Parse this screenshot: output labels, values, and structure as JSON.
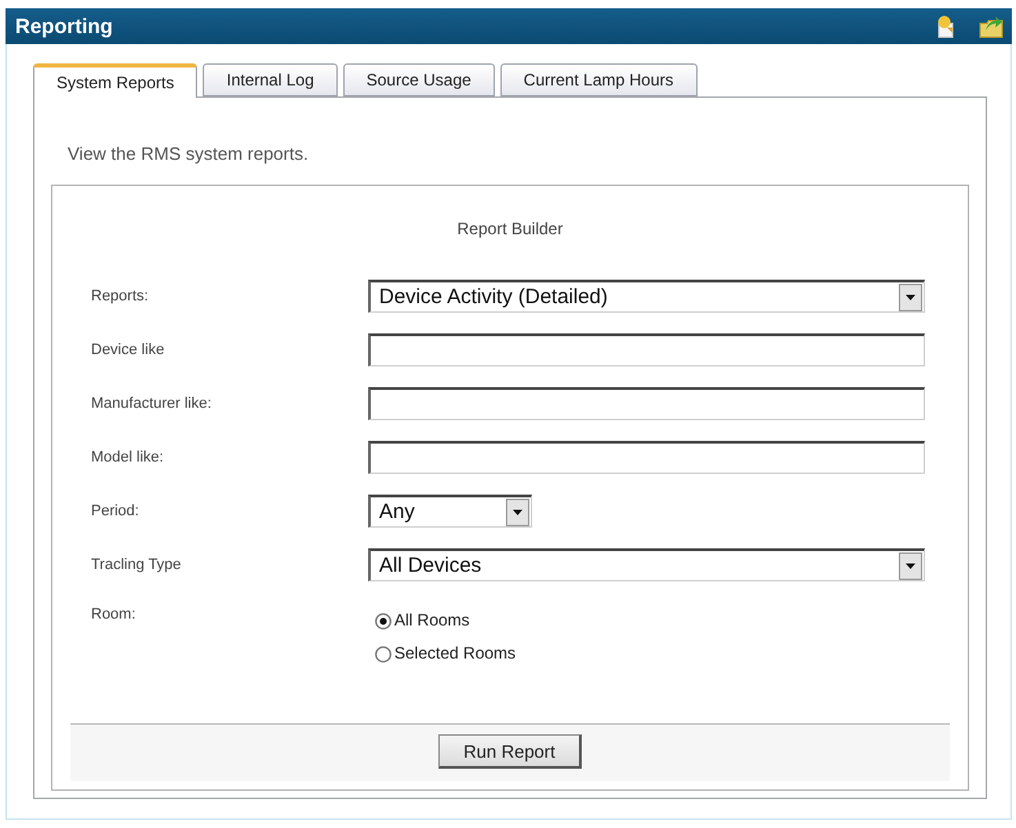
{
  "window": {
    "title": "Reporting"
  },
  "tabs": [
    {
      "label": "System Reports",
      "selected": true
    },
    {
      "label": "Internal Log",
      "selected": false
    },
    {
      "label": "Source Usage",
      "selected": false
    },
    {
      "label": "Current Lamp Hours",
      "selected": false
    }
  ],
  "description": "View the RMS system reports.",
  "report_builder": {
    "title": "Report Builder",
    "fields": [
      {
        "kind": "select",
        "label": "Reports:",
        "value": "Device Activity (Detailed)"
      },
      {
        "kind": "text",
        "label": "Device like"
      },
      {
        "kind": "text",
        "label": "Manufacturer like:"
      },
      {
        "kind": "text",
        "label": "Model like:"
      },
      {
        "kind": "short-select",
        "label": "Period:",
        "value": "Any"
      },
      {
        "kind": "select",
        "label": "Tracling Type",
        "value": "All Devices"
      },
      {
        "kind": "radio",
        "label": "Room:",
        "options": [
          {
            "label": "All Rooms",
            "selected": true
          },
          {
            "label": "Selected Rooms",
            "selected": false
          }
        ]
      }
    ],
    "button": "Run Report"
  }
}
